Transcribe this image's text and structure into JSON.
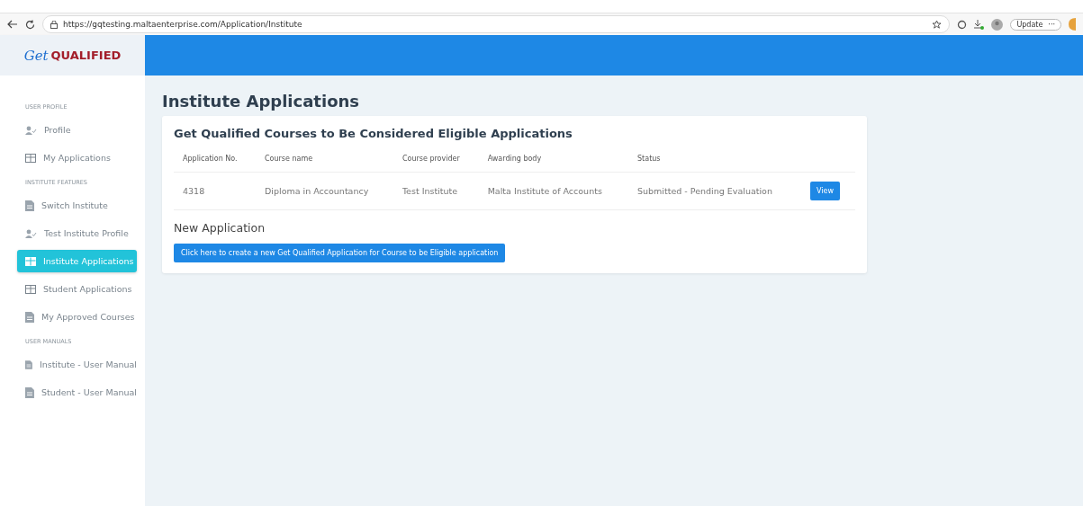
{
  "browser": {
    "url": "https://gqtesting.maltaenterprise.com/Application/Institute",
    "update_label": "Update",
    "more": "···"
  },
  "logo": {
    "script": "Get",
    "word": "QUALIFIED"
  },
  "sidebar": {
    "sections": [
      {
        "title": "USER PROFILE",
        "items": [
          {
            "label": "Profile",
            "kind": "person",
            "selected": false
          },
          {
            "label": "My Applications",
            "kind": "grid",
            "selected": false
          }
        ]
      },
      {
        "title": "INSTITUTE FEATURES",
        "items": [
          {
            "label": "Switch Institute",
            "kind": "document",
            "selected": false
          },
          {
            "label": "Test Institute Profile",
            "kind": "person",
            "selected": false
          },
          {
            "label": "Institute Applications",
            "kind": "grid",
            "selected": true
          },
          {
            "label": "Student Applications",
            "kind": "grid",
            "selected": false
          },
          {
            "label": "My Approved Courses",
            "kind": "document",
            "selected": false
          }
        ]
      },
      {
        "title": "USER MANUALS",
        "items": [
          {
            "label": "Institute - User Manual",
            "kind": "document",
            "selected": false
          },
          {
            "label": "Student - User Manual",
            "kind": "document",
            "selected": false
          }
        ]
      }
    ]
  },
  "page": {
    "title": "Institute Applications",
    "card": {
      "title": "Get Qualified Courses to Be Considered Eligible Applications",
      "table": {
        "columns": [
          "Application No.",
          "Course name",
          "Course provider",
          "Awarding body",
          "Status"
        ],
        "rows": [
          {
            "cells": [
              "4318",
              "Diploma in Accountancy",
              "Test Institute",
              "Malta Institute of Accounts",
              "Submitted - Pending Evaluation"
            ],
            "action": "View"
          }
        ]
      },
      "new_application": {
        "heading": "New Application",
        "button": "Click here to create a new Get Qualified Application for Course to be Eligible application"
      }
    }
  }
}
